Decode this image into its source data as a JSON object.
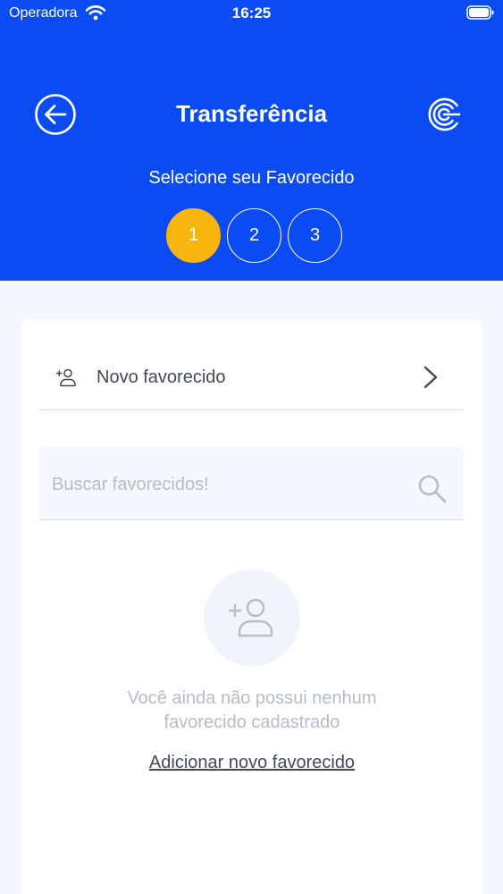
{
  "status_bar": {
    "carrier": "Operadora",
    "time": "16:25"
  },
  "header": {
    "title": "Transferência",
    "subtitle": "Selecione seu Favorecido",
    "back_icon": "arrow-left-circle-icon",
    "logo_icon": "brand-logo-icon",
    "background_color": "#0a4bf3"
  },
  "steps": [
    {
      "label": "1",
      "active": true
    },
    {
      "label": "2",
      "active": false
    },
    {
      "label": "3",
      "active": false
    }
  ],
  "colors": {
    "step_active": "#f8b40f",
    "page_background": "#f4f7fd",
    "text_primary": "#444a55",
    "text_muted": "#b7bcc7"
  },
  "new_favorite": {
    "label": "Novo favorecido",
    "icon": "add-user-icon"
  },
  "search": {
    "placeholder": "Buscar favorecidos!",
    "value": "",
    "icon": "search-icon"
  },
  "empty_state": {
    "icon": "add-user-icon",
    "message_line1": "Você ainda não possui nenhum",
    "message_line2": "favorecido cadastrado",
    "link": "Adicionar novo favorecido"
  }
}
